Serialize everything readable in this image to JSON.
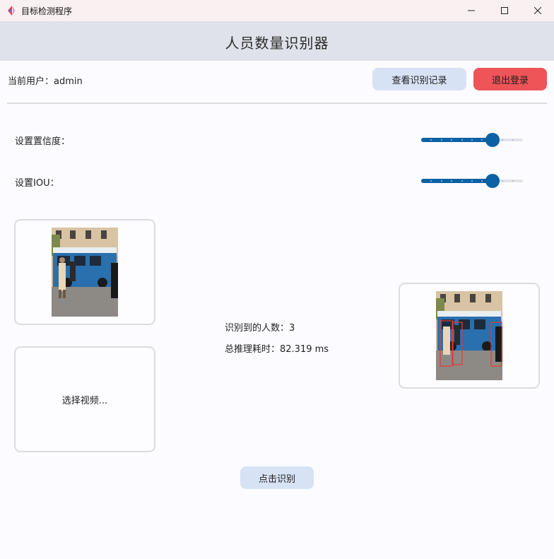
{
  "window": {
    "title": "目标检测程序"
  },
  "header": {
    "title": "人员数量识别器"
  },
  "user": {
    "label": "当前用户：admin"
  },
  "toolbar": {
    "records_label": "查看识别记录",
    "logout_label": "退出登录"
  },
  "settings": {
    "confidence_label": "设置置信度：",
    "confidence_value": 0.7,
    "iou_label": "设置IOU：",
    "iou_value": 0.7
  },
  "media": {
    "select_video_label": "选择视频..."
  },
  "results": {
    "count_label": "识别到的人数：3",
    "time_label": "总推理耗时：82.319 ms"
  },
  "actions": {
    "detect_label": "点击识别"
  },
  "colors": {
    "accent": "#0b61a4",
    "header_bg": "#dfe2ea",
    "button_bg": "#d7e3f4",
    "logout_bg": "#ee5458",
    "detection_box": "#e53935"
  },
  "icons": {
    "app": "app-logo-icon",
    "minimize": "minimize-icon",
    "maximize": "maximize-icon",
    "close": "close-icon"
  }
}
